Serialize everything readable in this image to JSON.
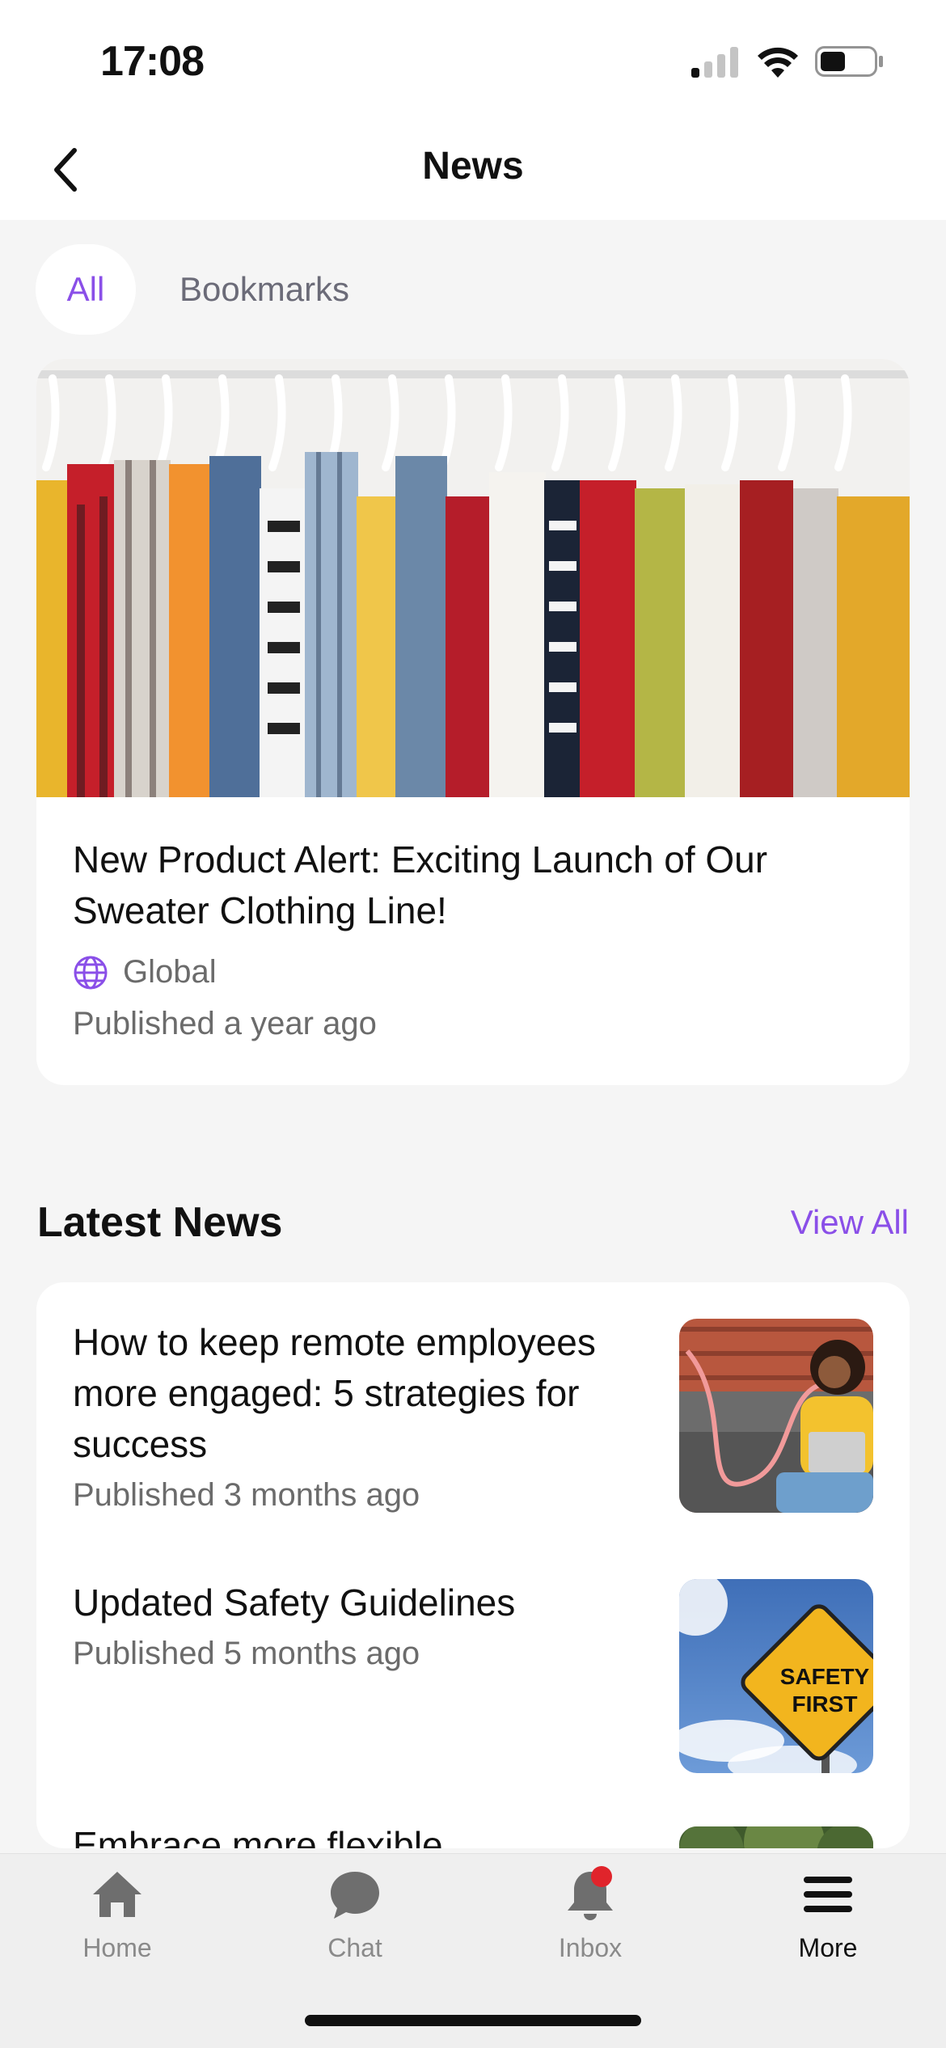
{
  "status_bar": {
    "time": "17:08"
  },
  "nav": {
    "title": "News"
  },
  "tabs": [
    {
      "label": "All",
      "active": true
    },
    {
      "label": "Bookmarks",
      "active": false
    }
  ],
  "featured": {
    "title": "New Product Alert: Exciting Launch of Our Sweater Clothing Line!",
    "audience": "Global",
    "published": "Published a year ago"
  },
  "latest": {
    "heading": "Latest News",
    "view_all": "View All",
    "items": [
      {
        "title": "How to keep remote employees more engaged: 5 strategies for success",
        "published": "Published 3 months ago"
      },
      {
        "title": "Updated Safety Guidelines",
        "published": "Published 5 months ago",
        "sign_line1": "SAFETY",
        "sign_line2": "FIRST"
      },
      {
        "title": "Embrace more flexible",
        "published": ""
      }
    ]
  },
  "tab_bar": {
    "items": [
      {
        "label": "Home",
        "icon": "home-icon"
      },
      {
        "label": "Chat",
        "icon": "chat-icon"
      },
      {
        "label": "Inbox",
        "icon": "bell-icon",
        "badge": true
      },
      {
        "label": "More",
        "icon": "menu-icon",
        "active": true
      }
    ]
  },
  "colors": {
    "accent": "#8a4fe8",
    "badge": "#e0242b",
    "background": "#f5f5f5"
  }
}
